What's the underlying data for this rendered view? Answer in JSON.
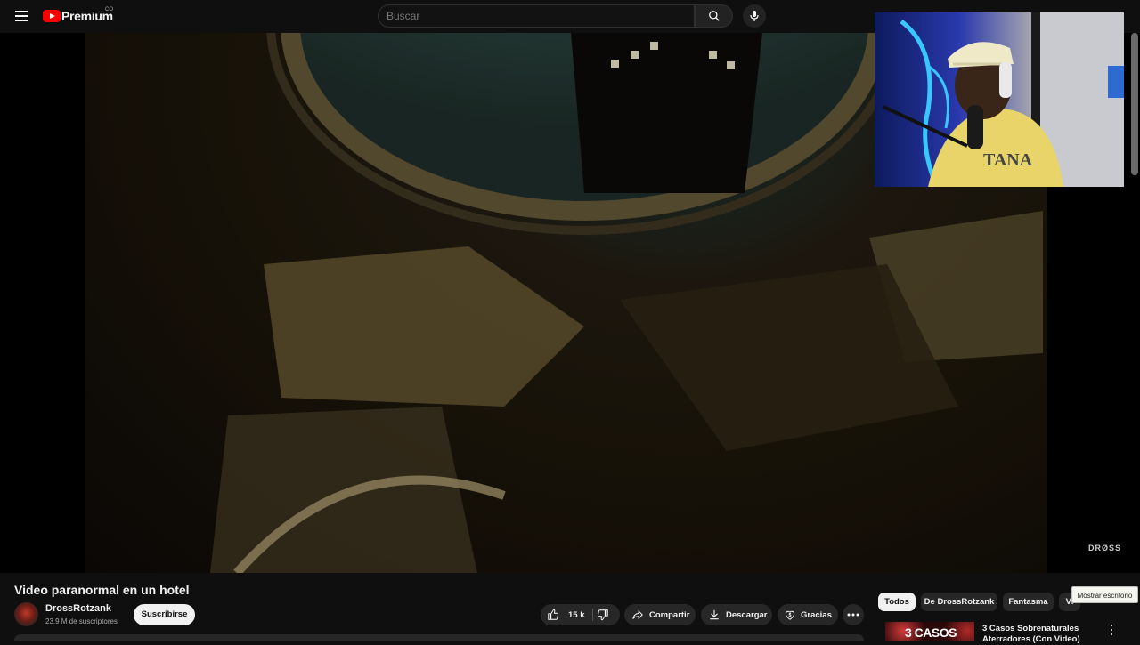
{
  "header": {
    "logo_text": "Premium",
    "logo_country": "CO",
    "search_placeholder": "Buscar"
  },
  "player": {
    "watermark": "DRØSS"
  },
  "video": {
    "title": "Video paranormal en un hotel",
    "channel_name": "DrossRotzank",
    "subscribers": "23.9 M de suscriptores",
    "subscribe_label": "Suscribirse",
    "likes": "15 k",
    "share_label": "Compartir",
    "download_label": "Descargar",
    "thanks_label": "Gracias"
  },
  "filters": {
    "chips": [
      "Todos",
      "De DrossRotzank",
      "Fantasma",
      "Vi"
    ],
    "active_index": 0
  },
  "tooltip": "Mostrar escritorio",
  "recommendations": [
    {
      "thumb_text": "3 CASOS",
      "title": "3 Casos Sobrenaturales Aterradores (Con Video)"
    }
  ],
  "colors": {
    "background": "#0f0f0f",
    "brand_red": "#ff0000",
    "chip_bg": "#272727",
    "text": "#f1f1f1"
  }
}
